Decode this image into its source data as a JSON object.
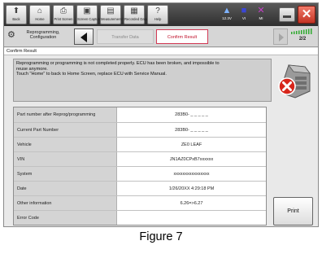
{
  "toolbar": {
    "buttons": [
      {
        "icon": "back-icon",
        "label": "Back"
      },
      {
        "icon": "home-icon",
        "label": "Home"
      },
      {
        "icon": "print-icon",
        "label": "Print Screen"
      },
      {
        "icon": "camera-icon",
        "label": "Screen Capture"
      },
      {
        "icon": "measure-icon",
        "label": "Measurement Mode"
      },
      {
        "icon": "recorded-data-icon",
        "label": "Recorded Data"
      },
      {
        "icon": "help-icon",
        "label": "Help"
      }
    ],
    "status": [
      {
        "icon": "vehicle-icon",
        "label": "12.3V"
      },
      {
        "icon": "vi-icon",
        "label": "VI"
      },
      {
        "icon": "mi-icon",
        "label": "MI"
      }
    ]
  },
  "breadcrumb": {
    "label": "Reprogramming, Configuration",
    "steps": [
      "Transfer Data",
      "Confirm Result"
    ],
    "page_indicator": "2/2"
  },
  "section_title": "Confirm Result",
  "message": {
    "lines": [
      "Reprogramming or programming is not completed properly. ECU has been broken, and impossible to",
      "reuse anymore.",
      "Touch \"Home\" to back to Home Screen, replace ECU with Service Manual."
    ]
  },
  "result_table": {
    "rows": [
      {
        "label": "Part number after Reprog/programming",
        "value": "283B0- _ _ _ _ _"
      },
      {
        "label": "Current Part Number",
        "value": "283B0- _ _ _ _ _"
      },
      {
        "label": "Vehicle",
        "value": "ZE0 LEAF"
      },
      {
        "label": "VIN",
        "value": "JN1AZ0CPxB7xxxxxx"
      },
      {
        "label": "System",
        "value": "xxxxxxxxxxxxxxxx"
      },
      {
        "label": "Date",
        "value": "1/26/20XX 4:29:18 PM"
      },
      {
        "label": "Other information",
        "value": "6.26=>6.27"
      },
      {
        "label": "Error Code",
        "value": ""
      }
    ]
  },
  "print_label": "Print",
  "caption": "Figure 7",
  "colors": {
    "accent_red": "#c0102a",
    "close_red": "#d2402f",
    "signal_green": "#2faa2f"
  }
}
